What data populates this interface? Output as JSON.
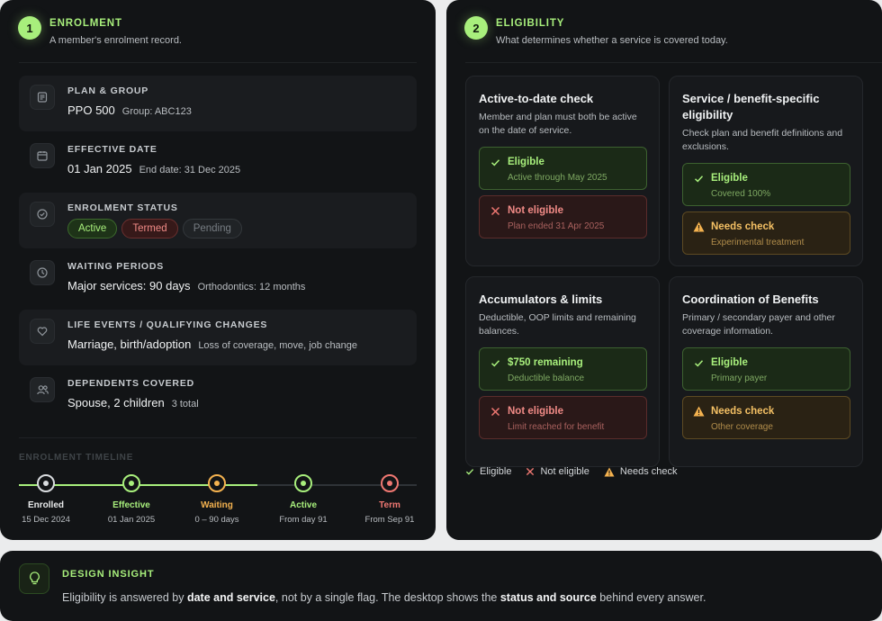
{
  "enrolment": {
    "number": "1",
    "title": "ENROLMENT",
    "subtitle": "A member's enrolment record.",
    "rows": [
      {
        "label": "PLAN & GROUP",
        "main": "PPO 500",
        "secondary": "Group: ABC123",
        "icon": "document-icon"
      },
      {
        "label": "EFFECTIVE DATE",
        "main": "01 Jan 2025",
        "secondary": "End date: 31 Dec 2025",
        "icon": "calendar-icon"
      },
      {
        "label": "ENROLMENT STATUS",
        "icon": "check-circle-icon",
        "pills": [
          "Active",
          "Termed",
          "Pending"
        ]
      },
      {
        "label": "WAITING PERIODS",
        "main": "Major services: 90 days",
        "secondary": "Orthodontics: 12 months",
        "icon": "clock-icon"
      },
      {
        "label": "LIFE EVENTS / QUALIFYING CHANGES",
        "main": "Marriage, birth/adoption",
        "secondary": "Loss of coverage, move, job change",
        "icon": "heart-icon"
      },
      {
        "label": "DEPENDENTS COVERED",
        "main": "Spouse, 2 children",
        "secondary": "3 total",
        "icon": "users-icon"
      }
    ],
    "timeline": {
      "title": "ENROLMENT TIMELINE",
      "steps": [
        {
          "label": "Enrolled",
          "date": "15 Dec 2024",
          "color": "#d9dcdf"
        },
        {
          "label": "Effective",
          "date": "01 Jan 2025",
          "color": "#a8ef7c"
        },
        {
          "label": "Waiting",
          "date": "0 – 90 days",
          "color": "#f4b24f"
        },
        {
          "label": "Active",
          "date": "From day 91",
          "color": "#a8ef7c"
        },
        {
          "label": "Term",
          "date": "From Sep 91",
          "color": "#f07872"
        }
      ]
    }
  },
  "eligibility": {
    "number": "2",
    "title": "ELIGIBILITY",
    "subtitle": "What determines whether a service is covered today.",
    "cards": [
      {
        "title": "Active-to-date check",
        "desc": "Member and plan must both be active on the date of service.",
        "statuses": [
          {
            "kind": "ok",
            "title": "Eligible",
            "sub": "Active through May 2025"
          },
          {
            "kind": "bad",
            "title": "Not eligible",
            "sub": "Plan ended 31 Apr 2025"
          }
        ]
      },
      {
        "title": "Service / benefit-specific eligibility",
        "desc": "Check plan and benefit definitions and exclusions.",
        "statuses": [
          {
            "kind": "ok",
            "title": "Eligible",
            "sub": "Covered 100%"
          },
          {
            "kind": "warn",
            "title": "Needs check",
            "sub": "Experimental treatment"
          }
        ]
      },
      {
        "title": "Accumulators & limits",
        "desc": "Deductible, OOP limits and remaining balances.",
        "statuses": [
          {
            "kind": "ok",
            "title": "$750 remaining",
            "sub": "Deductible balance"
          },
          {
            "kind": "bad",
            "title": "Not eligible",
            "sub": "Limit reached for benefit"
          }
        ]
      },
      {
        "title": "Coordination of Benefits",
        "desc": "Primary / secondary payer and other coverage information.",
        "statuses": [
          {
            "kind": "ok",
            "title": "Eligible",
            "sub": "Primary payer"
          },
          {
            "kind": "warn",
            "title": "Needs check",
            "sub": "Other coverage"
          }
        ]
      }
    ],
    "legend": [
      {
        "kind": "ok",
        "label": "Eligible"
      },
      {
        "kind": "bad",
        "label": "Not eligible"
      },
      {
        "kind": "warn",
        "label": "Needs check"
      }
    ]
  },
  "insight": {
    "title": "DESIGN INSIGHT",
    "text_1": "Eligibility is answered by ",
    "bold_1": "date and service",
    "text_2": ", not by a single flag. The desktop shows the ",
    "bold_2": "status and source",
    "text_3": " behind every answer.",
    "icon": "lightbulb-icon"
  },
  "colors": {
    "accent": "#a8ef7c",
    "error": "#f07872",
    "warning": "#f4b24f"
  }
}
